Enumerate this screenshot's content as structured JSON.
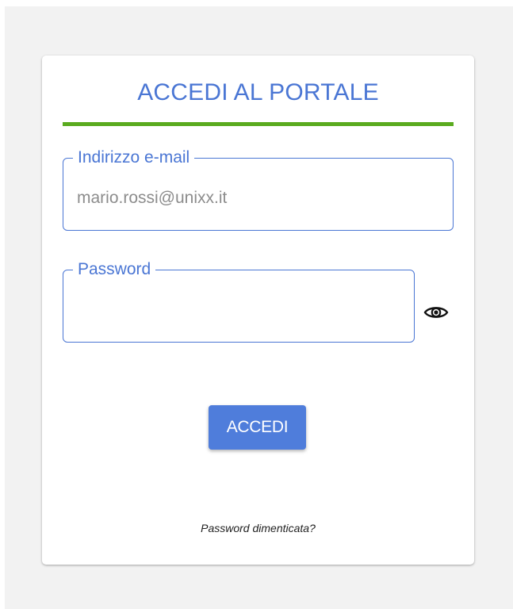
{
  "login_card": {
    "title": "ACCEDI AL PORTALE",
    "email_field": {
      "label": "Indirizzo e-mail",
      "value": "mario.rossi@unixx.it"
    },
    "password_field": {
      "label": "Password",
      "value": "",
      "toggle_icon": "eye-icon"
    },
    "submit_label": "ACCEDI",
    "forgot_password_label": "Password dimenticata?"
  },
  "colors": {
    "accent_blue": "#4a76d4",
    "button_blue": "#4f7ddb",
    "divider_green": "#5aab1f",
    "page_background": "#f2f2f2"
  }
}
